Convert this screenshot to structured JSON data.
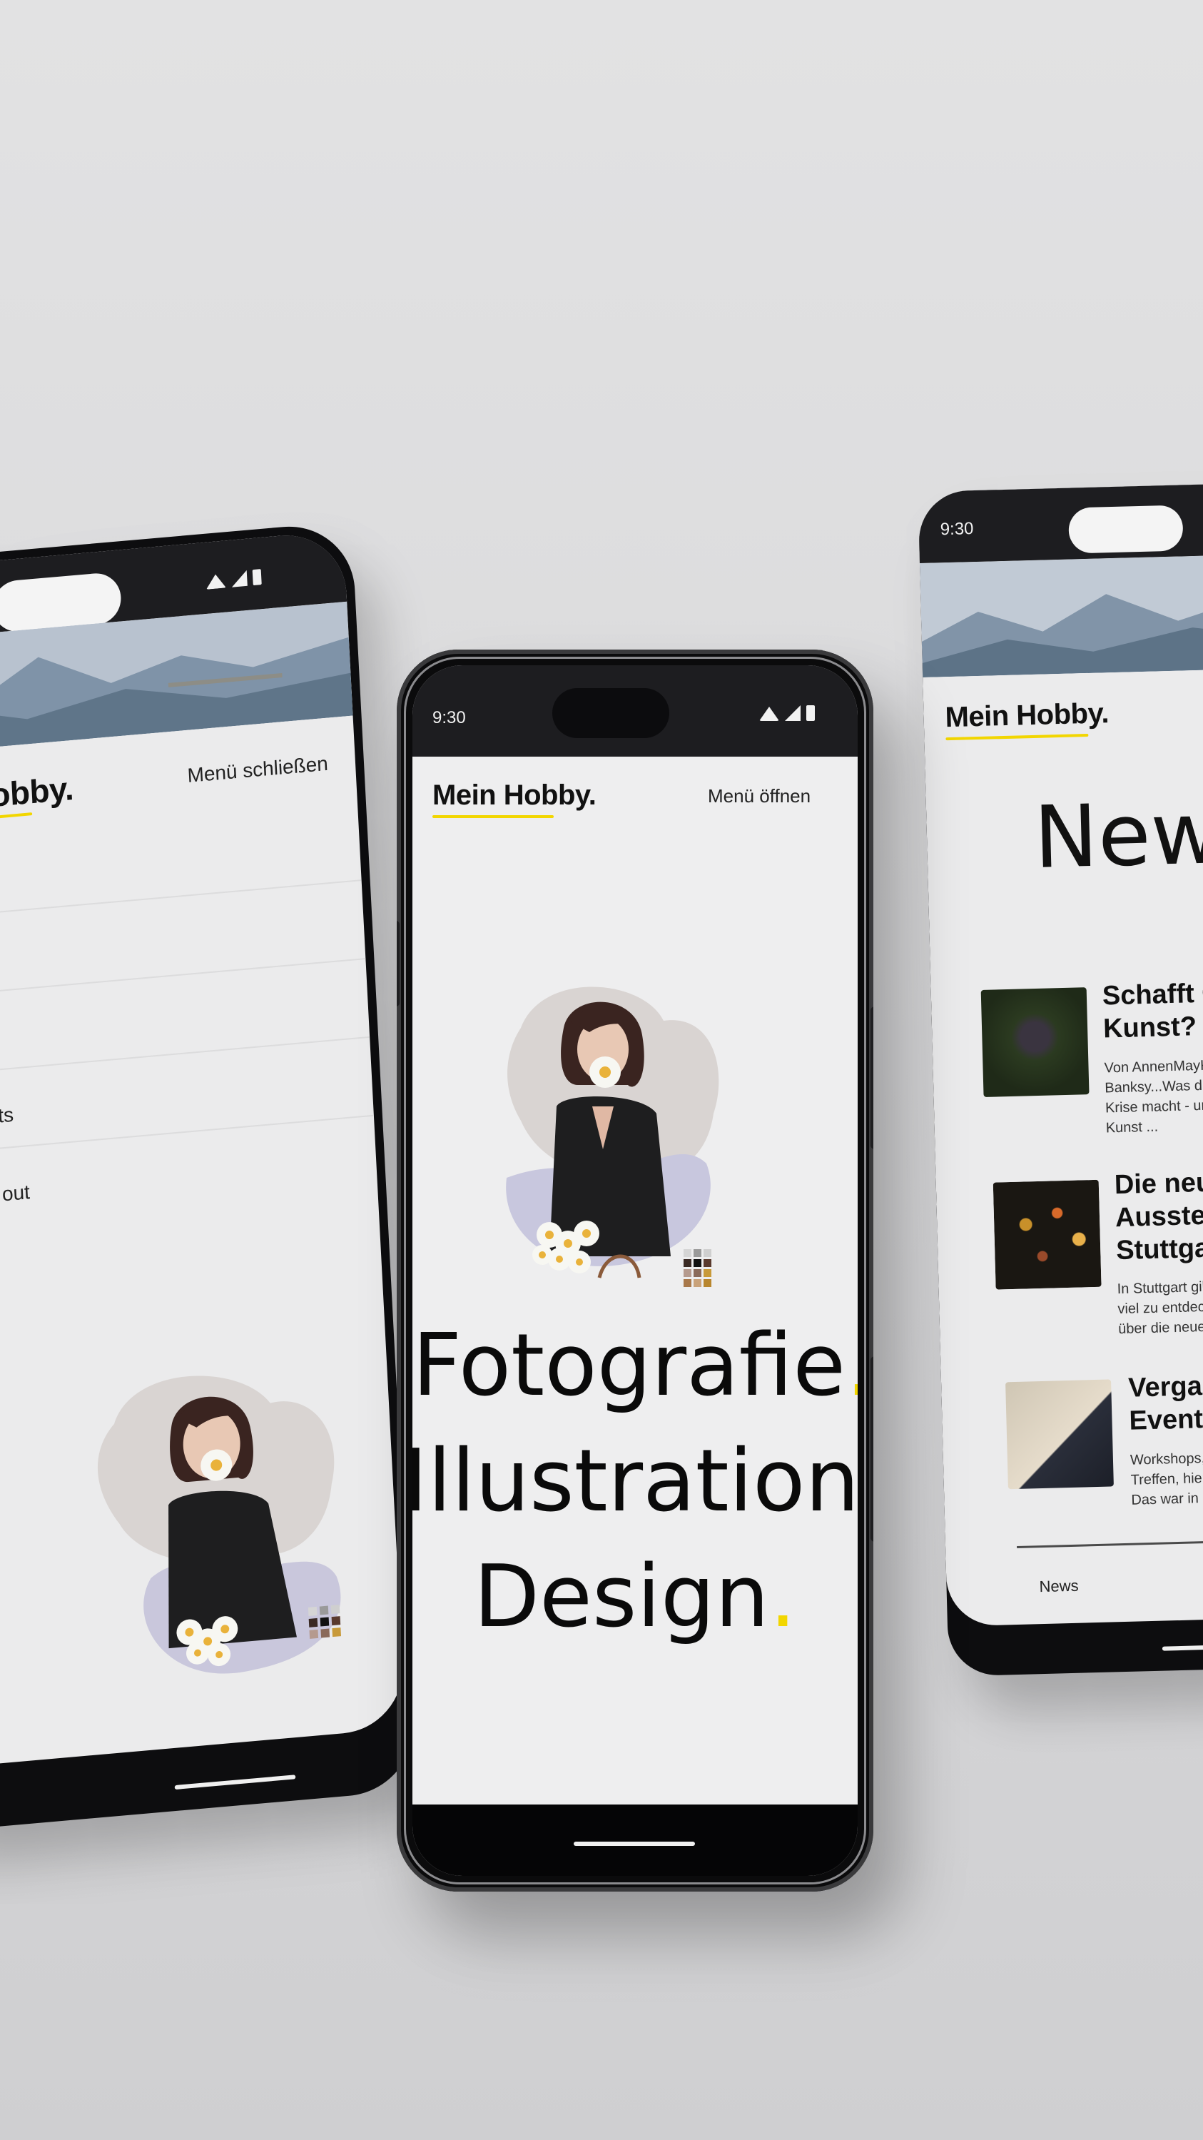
{
  "colors": {
    "accent_yellow": "#f2d600",
    "background": "#dcdcde",
    "screen_bg": "#eeeeef",
    "statusbar": "#1d1d20",
    "text": "#111111"
  },
  "center_phone": {
    "status_time": "9:30",
    "logo": "Mein Hobby.",
    "menu_label": "Menü öffnen",
    "hero": {
      "line1": "Fotografie",
      "line2": "Illustration",
      "line3": "Design",
      "dot": "."
    },
    "icons": [
      "wifi-icon",
      "signal-icon",
      "battery-icon"
    ]
  },
  "left_phone": {
    "logo": "Hobby.",
    "menu_label": "Menü schließen",
    "menu_items": [
      "",
      "",
      "",
      "ts",
      "out"
    ]
  },
  "right_phone": {
    "status_time": "9:30",
    "logo": "Mein Hobby.",
    "page_title": "News",
    "articles": [
      {
        "title_line1": "Schafft C",
        "title_line2": "Kunst?",
        "desc_line1": "Von AnnenMayK",
        "desc_line2": "Banksy...Was die",
        "desc_line3": "Krise macht - ur",
        "desc_line4": "Kunst ..."
      },
      {
        "title_line1": "Die neu",
        "title_line2": "Ausstel",
        "title_line3": "Stuttga",
        "desc_line1": "In Stuttgart gib",
        "desc_line2": "viel zu entdeck",
        "desc_line3": "über die neues"
      },
      {
        "title_line1": "Vergan",
        "title_line2": "Events",
        "desc_line1": "Workshops,A",
        "desc_line2": "Treffen, hier w",
        "desc_line3": "Das war in de"
      }
    ],
    "footer_link": "News"
  }
}
